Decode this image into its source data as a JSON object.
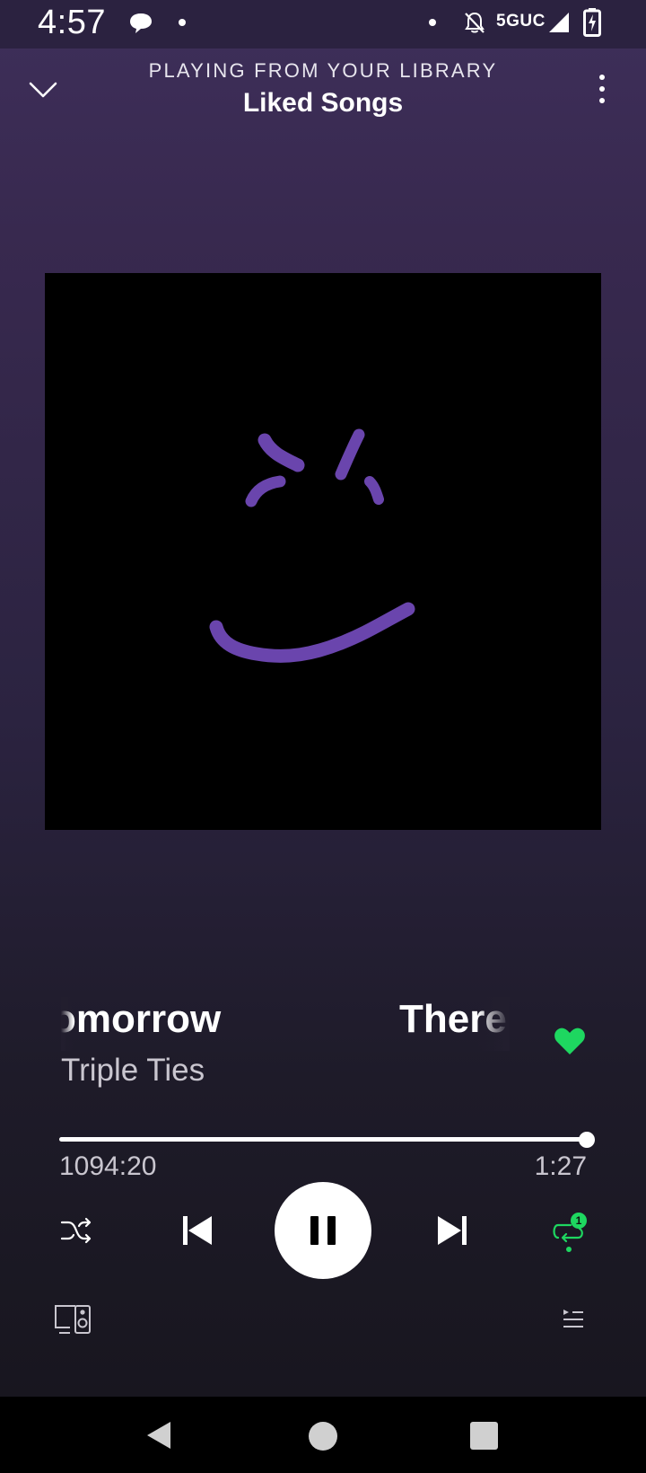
{
  "status_bar": {
    "time": "4:57",
    "network": "5GUC"
  },
  "header": {
    "context_label": "PLAYING FROM YOUR LIBRARY",
    "playlist_title": "Liked Songs"
  },
  "track": {
    "title_scroll_current": "omorrow",
    "title_scroll_next": "There",
    "artist": "Triple Ties",
    "liked": true
  },
  "progress": {
    "elapsed": "1094:20",
    "total": "1:27",
    "fraction": 1.0
  },
  "controls": {
    "shuffle": "shuffle-icon",
    "previous": "skip-previous-icon",
    "play_state": "playing",
    "next": "skip-next-icon",
    "repeat_mode": "repeat-one",
    "repeat_badge": "1"
  },
  "bottom_actions": {
    "devices": "connect-devices-icon",
    "queue": "queue-icon"
  },
  "colors": {
    "accent_green": "#1ed760",
    "art_stroke": "#6a45ad",
    "art_background": "#000000"
  }
}
